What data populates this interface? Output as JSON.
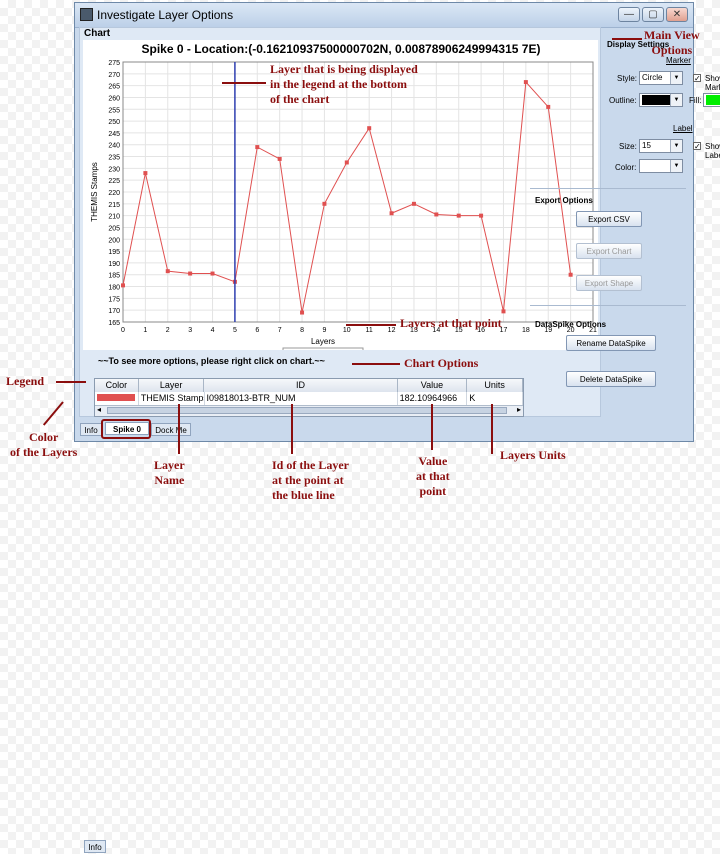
{
  "window": {
    "title": "Investigate Layer Options",
    "min": "—",
    "max": "▢",
    "close": "✕"
  },
  "chart_panel": {
    "label": "Chart",
    "hint": "~~To see more options, please right click on chart.~~"
  },
  "chart_data": {
    "type": "line",
    "title": "Spike 0 - Location:(-0.16210937500000702N, 0.00878906249994315 7E)",
    "xlabel": "Layers",
    "ylabel": "THEMIS Stamps",
    "xlim": [
      0,
      21
    ],
    "ylim": [
      165,
      275
    ],
    "xticks": [
      0,
      1,
      2,
      3,
      4,
      5,
      6,
      7,
      8,
      9,
      10,
      11,
      12,
      13,
      14,
      15,
      16,
      17,
      18,
      19,
      20,
      21
    ],
    "yticks": [
      165,
      170,
      175,
      180,
      185,
      190,
      195,
      200,
      205,
      210,
      215,
      220,
      225,
      230,
      235,
      240,
      245,
      250,
      255,
      260,
      265,
      270,
      275
    ],
    "series": [
      {
        "name": "THEMIS Stamps",
        "color": "#e05050",
        "x": [
          0,
          1,
          2,
          3,
          4,
          5,
          6,
          7,
          8,
          9,
          10,
          11,
          12,
          13,
          14,
          15,
          16,
          17,
          18,
          19,
          20
        ],
        "y": [
          180.5,
          228,
          186.5,
          185.5,
          185.5,
          182,
          239,
          234,
          169,
          215,
          232.5,
          247,
          211,
          215,
          210.5,
          210,
          210,
          169.5,
          266.5,
          256,
          185
        ]
      }
    ],
    "marker_x": 5,
    "legend": "bottom-center",
    "grid": true
  },
  "legend_table": {
    "headers": [
      "Color",
      "Layer",
      "ID",
      "Value",
      "Units"
    ],
    "rows": [
      {
        "color": "#e05050",
        "layer": "THEMIS Stamps",
        "id": "I09818013-BTR_NUM",
        "value": "182.10964966",
        "units": "K"
      }
    ]
  },
  "side": {
    "display_settings": "Display Settings",
    "marker": "Marker",
    "style_label": "Style:",
    "style_value": "Circle",
    "show_marker": "Show Marker",
    "outline_label": "Outline:",
    "fill_label": "Fill:",
    "outline_color": "#000000",
    "fill_color": "#00ee00",
    "label": "Label",
    "size_label": "Size:",
    "size_value": "15",
    "show_label": "Show Label",
    "color_label": "Color:",
    "export_options": "Export Options",
    "export_csv": "Export CSV",
    "export_chart": "Export Chart",
    "export_shape": "Export Shape",
    "dataspike_options": "DataSpike Options",
    "rename": "Rename DataSpike",
    "delete": "Delete DataSpike"
  },
  "tabs": [
    "Info",
    "Spike 0",
    "Dock Me"
  ],
  "annotations": {
    "main_view": "Main View\nOptions",
    "layer_displayed": "Layer that is being displayed\nin the legend at the bottom\nof the chart",
    "layers_point": "Layers at that point",
    "chart_options": "Chart Options",
    "legend": "Legend",
    "color_layers": "Color\nof the Layers",
    "layer_name": "Layer\nName",
    "id_layer": "Id of the Layer\nat the point at\nthe blue line",
    "value_point": "Value\nat that\npoint",
    "layers_units": "Layers Units"
  }
}
